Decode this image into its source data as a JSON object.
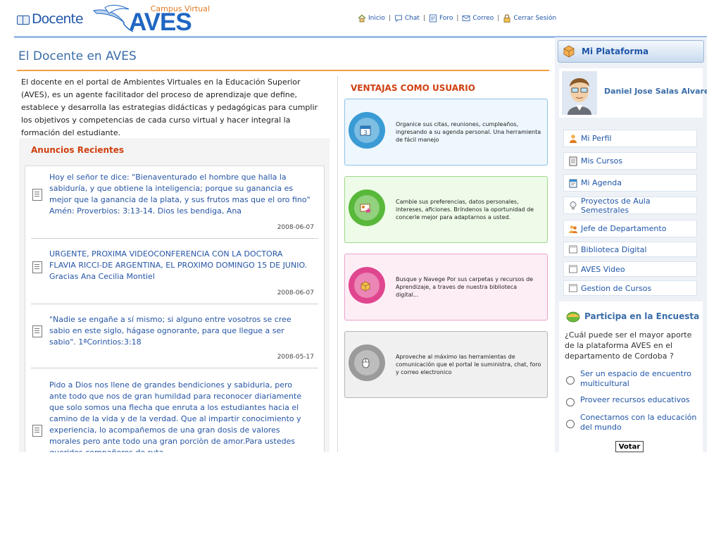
{
  "header": {
    "logo_text": "Docente",
    "brand_subtitle": "Campus Virtual",
    "brand_name": "AVES",
    "nav": [
      {
        "label": "Inicio",
        "icon": "home-icon"
      },
      {
        "label": "Chat",
        "icon": "chat-bubble-icon"
      },
      {
        "label": "Foro",
        "icon": "forum-icon"
      },
      {
        "label": "Correo",
        "icon": "envelope-icon"
      },
      {
        "label": "Cerrar Sesión",
        "icon": "lock-icon"
      }
    ],
    "nav_separator": "|"
  },
  "main": {
    "title": "El Docente en AVES",
    "intro": "El docente en el portal de Ambientes Virtuales en la Educación Superior (AVES), es un agente facilitador del proceso de aprendizaje que define, establece y desarrolla las estrategias didácticas y pedagógicas para cumplir los objetivos y competencias de cada curso virtual y hacer integral la formación del estudiante.",
    "announcements_title": "Anuncios Recientes",
    "announcements": [
      {
        "text": "Hoy el señor te dice: \"Bienaventurado el hombre que halla la sabiduría, y que obtiene la inteligencia; porque su ganancia es mejor que la ganancia de la plata, y sus frutos mas que el oro fino\" Amén: Proverbios: 3:13-14. Dios les bendiga, Ana",
        "date": "2008-06-07"
      },
      {
        "text": "URGENTE, PROXIMA VIDEOCONFERENCIA CON LA DOCTORA FLAVIA RICCI-DE ARGENTINA, EL PROXIMO DOMINGO 15 DE JUNIO. Gracias Ana Cecilia Montiel",
        "date": "2008-06-07"
      },
      {
        "text": "\"Nadie se engañe a sí mismo; si alguno entre vosotros se cree sabio en este siglo, hágase ognorante, para que llegue a ser sabio\". 1ªCorintios:3:18",
        "date": "2008-05-17"
      },
      {
        "text": "Pido a Dios nos llene de grandes bendiciones y sabiduria, pero ante todo que nos de gran humildad para reconocer diariamente que solo somos una flecha que enruta a los estudiantes hacia el camino de la vida y de la verdad. Que al impartir conocimiento y experiencia, lo acompañemos de una gran dosis de valores morales pero ante todo una gran porciòn de amor.Para ustedes queridos compañeros de ruta,",
        "date": ""
      }
    ]
  },
  "ventajas": {
    "title": "VENTAJAS COMO USUARIO",
    "cards": [
      {
        "text": "Organice sus citas, reuniones, cumpleaños, ingresando a su agenda personal. Una herramienta de fácil manejo",
        "icon": "calendar-icon",
        "bg": "#eef7fd",
        "border": "#8fc3e3",
        "circle": "#3a9bd5"
      },
      {
        "text": "Cambie sus preferencias, datos personales, intereses, aficiones. Bríndenos la oportunidad de concerle mejor para adaptarnos a usted.",
        "icon": "profile-card-icon",
        "bg": "#eefbe8",
        "border": "#9fd68a",
        "circle": "#58b83a"
      },
      {
        "text": "Busque y Navege Por sus carpetas y recursos de Aprendizaje, a traves de nuestra biblioteca digital...",
        "icon": "open-box-icon",
        "bg": "#fdeef6",
        "border": "#eaa3c9",
        "circle": "#e0468f"
      },
      {
        "text": "Aproveche al máximo las herramientas de comunicación que el portal le suministra, chat, foro y correo electronico",
        "icon": "mouse-icon",
        "bg": "#f0f0f0",
        "border": "#b5b5b5",
        "circle": "#9a9a9a"
      }
    ]
  },
  "sidebar": {
    "title": "Mi Plataforma",
    "user_name": "Daniel Jose Salas Alvarez",
    "menu": [
      {
        "label": "Mi Perfil",
        "icon": "person-icon"
      },
      {
        "label": "Mis Cursos",
        "icon": "document-icon"
      },
      {
        "label": "Mi Agenda",
        "icon": "agenda-icon"
      },
      {
        "label": "Proyectos de Aula Semestrales",
        "icon": "lightbulb-icon"
      },
      {
        "label": "Jefe de Departamento",
        "icon": "people-icon"
      },
      {
        "label": "Biblioteca Digital",
        "icon": "window-icon"
      },
      {
        "label": "AVES Video",
        "icon": "window-icon"
      },
      {
        "label": "Gestion de Cursos",
        "icon": "window-icon"
      }
    ],
    "survey": {
      "title": "Participa en la Encuesta",
      "question": "¿Cuál puede ser el mayor aporte de la plataforma AVES en el departamento de Cordoba ?",
      "options": [
        "Ser un espacio de encuentro multicultural",
        "Proveer recursos educativos",
        "Conectarnos con la educación del mundo"
      ],
      "submit": "Votar"
    }
  }
}
